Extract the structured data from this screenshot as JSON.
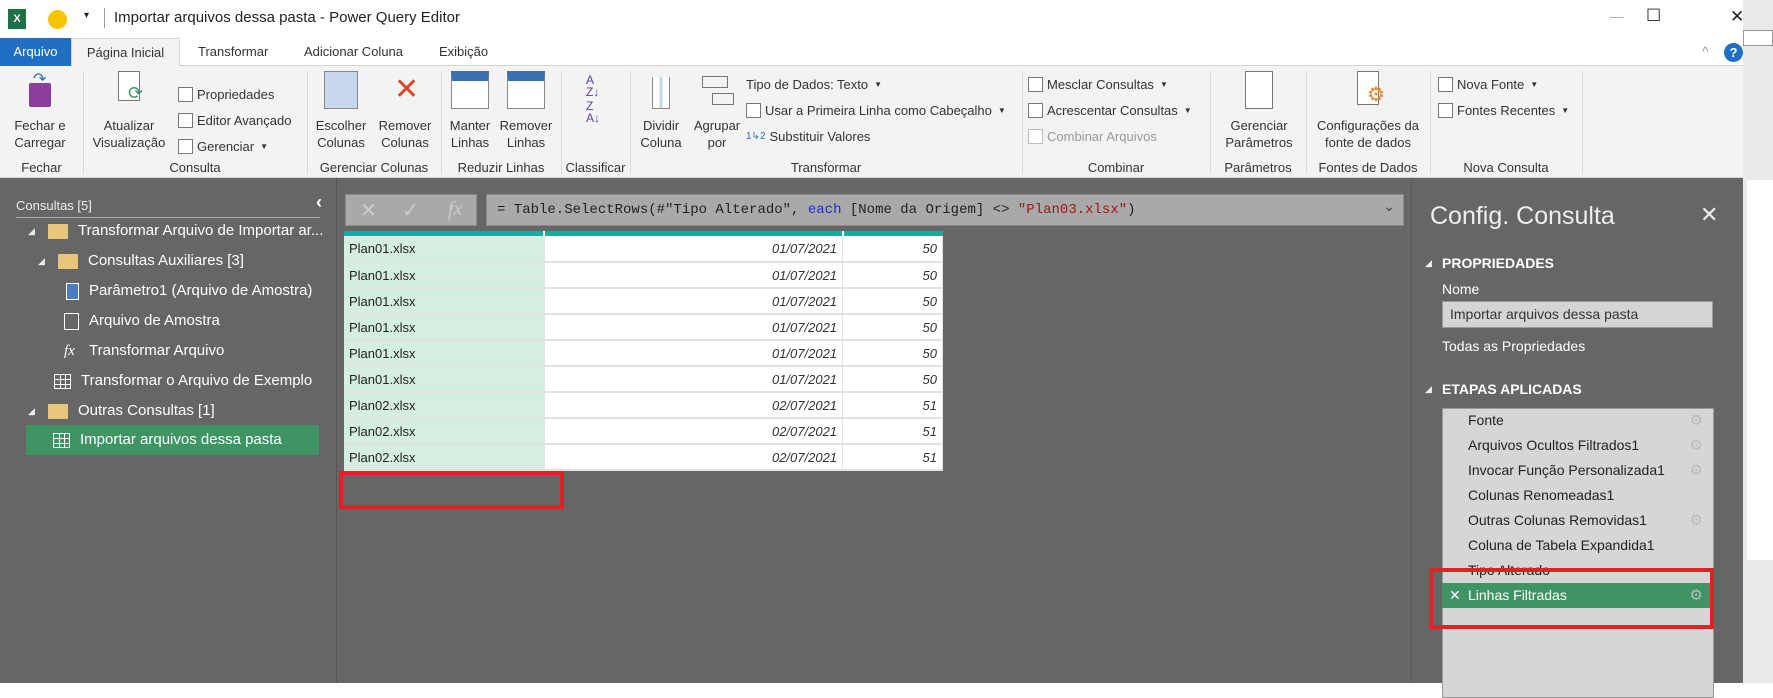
{
  "window": {
    "title": "Importar arquivos dessa pasta - Power Query Editor",
    "minimize": "—",
    "maximize": "☐",
    "close": "✕"
  },
  "tabs": [
    {
      "label": "Arquivo"
    },
    {
      "label": "Página Inicial"
    },
    {
      "label": "Transformar"
    },
    {
      "label": "Adicionar Coluna"
    },
    {
      "label": "Exibição"
    }
  ],
  "ribbon": {
    "fechar": {
      "button": "Fechar e\nCarregar",
      "group": "Fechar"
    },
    "consulta": {
      "atualizar": "Atualizar\nVisualização",
      "propriedades": "Propriedades",
      "editor": "Editor Avançado",
      "gerenciar": "Gerenciar",
      "group": "Consulta"
    },
    "colunas": {
      "escolher": "Escolher\nColunas",
      "remover": "Remover\nColunas",
      "group": "Gerenciar Colunas"
    },
    "linhas": {
      "manter": "Manter\nLinhas",
      "remover": "Remover\nLinhas",
      "group": "Reduzir Linhas"
    },
    "classificar": {
      "group": "Classificar"
    },
    "transformar": {
      "dividir": "Dividir\nColuna",
      "agrupar": "Agrupar\npor",
      "tipo": "Tipo de Dados: Texto",
      "usar": "Usar a Primeira Linha como Cabeçalho",
      "substituir": "Substituir Valores",
      "group": "Transformar"
    },
    "combinar": {
      "mesclar": "Mesclar Consultas",
      "acrescentar": "Acrescentar Consultas",
      "combinar": "Combinar Arquivos",
      "group": "Combinar"
    },
    "parametros": {
      "gerenciar": "Gerenciar\nParâmetros",
      "group": "Parâmetros"
    },
    "fontes": {
      "config": "Configurações da\nfonte de dados",
      "group": "Fontes de Dados"
    },
    "nova": {
      "nova_fonte": "Nova Fonte",
      "recentes": "Fontes Recentes",
      "group": "Nova Consulta"
    }
  },
  "queries": {
    "header": "Consultas [5]",
    "items": [
      {
        "label": "Transformar Arquivo de Importar ar...",
        "icon": "folder-icon"
      },
      {
        "label": "Consultas Auxiliares [3]",
        "icon": "folder-icon"
      },
      {
        "label": "Parâmetro1 (Arquivo de Amostra)",
        "icon": "parameter-icon"
      },
      {
        "label": "Arquivo de Amostra",
        "icon": "document-icon"
      },
      {
        "label": "Transformar Arquivo",
        "icon": "function-icon"
      },
      {
        "label": "Transformar o Arquivo de Exemplo",
        "icon": "table-icon"
      },
      {
        "label": "Outras Consultas [1]",
        "icon": "folder-icon"
      },
      {
        "label": "Importar arquivos dessa pasta",
        "icon": "table-icon",
        "selected": true
      }
    ]
  },
  "formula": {
    "prefix": "= Table.SelectRows(#\"Tipo Alterado\", ",
    "keyword": "each",
    "field": " [Nome da Origem] <> ",
    "string": "\"Plan03.xlsx\"",
    "suffix": ")"
  },
  "table": {
    "rows": [
      [
        "Plan01.xlsx",
        "01/07/2021",
        "50"
      ],
      [
        "Plan01.xlsx",
        "01/07/2021",
        "50"
      ],
      [
        "Plan01.xlsx",
        "01/07/2021",
        "50"
      ],
      [
        "Plan01.xlsx",
        "01/07/2021",
        "50"
      ],
      [
        "Plan01.xlsx",
        "01/07/2021",
        "50"
      ],
      [
        "Plan01.xlsx",
        "01/07/2021",
        "50"
      ],
      [
        "Plan02.xlsx",
        "02/07/2021",
        "51"
      ],
      [
        "Plan02.xlsx",
        "02/07/2021",
        "51"
      ],
      [
        "Plan02.xlsx",
        "02/07/2021",
        "51"
      ]
    ]
  },
  "settings": {
    "title": "Config. Consulta",
    "properties_header": "PROPRIEDADES",
    "name_label": "Nome",
    "name_value": "Importar arquivos dessa pasta",
    "all_properties": "Todas as Propriedades",
    "steps_header": "ETAPAS APLICADAS",
    "steps": [
      {
        "label": "Fonte",
        "gear": true
      },
      {
        "label": "Arquivos Ocultos Filtrados1",
        "gear": true
      },
      {
        "label": "Invocar Função Personalizada1",
        "gear": true
      },
      {
        "label": "Colunas Renomeadas1",
        "gear": false
      },
      {
        "label": "Outras Colunas Removidas1",
        "gear": true
      },
      {
        "label": "Coluna de Tabela Expandida1",
        "gear": false
      },
      {
        "label": "Tipo Alterado",
        "gear": false
      },
      {
        "label": "Linhas Filtradas",
        "gear": true,
        "selected": true
      }
    ]
  },
  "colors": {
    "accent_green": "#3f9463",
    "file_tab": "#1f6fc5",
    "header_teal": "#00b3a4",
    "highlight_red": "#e81d25"
  }
}
